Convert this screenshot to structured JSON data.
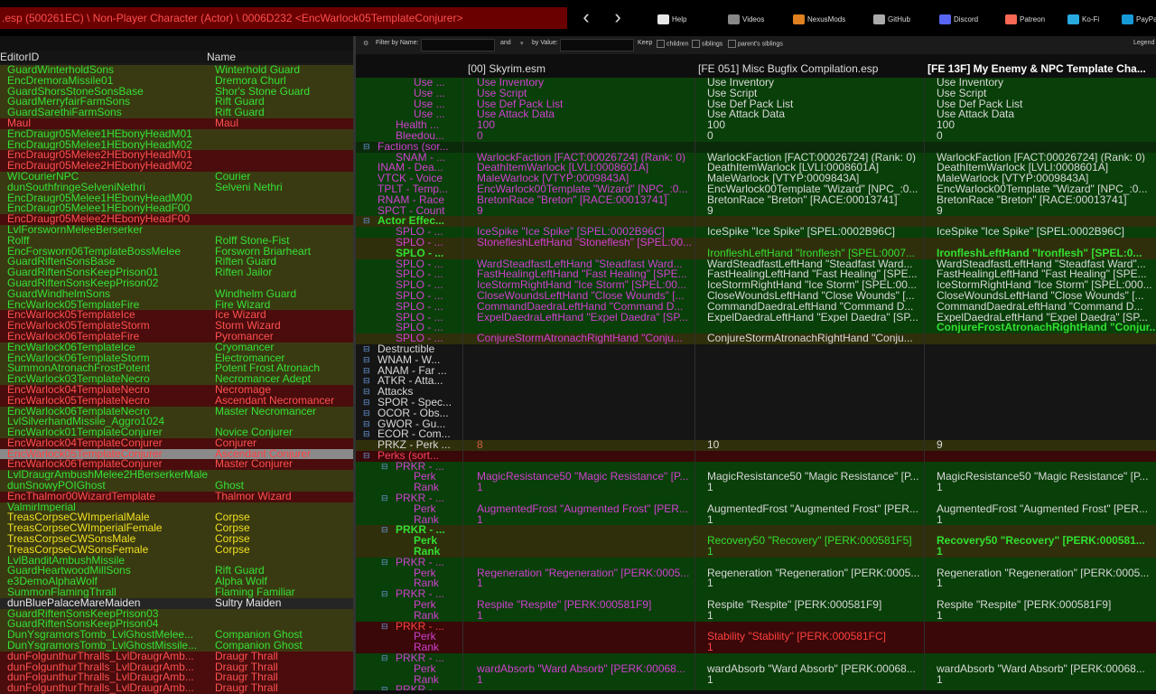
{
  "path_title": ".esp (500261EC) \\ Non-Player Character (Actor) \\ 0006D232 <EncWarlock05TemplateConjurer>",
  "toolbar": {
    "back": "‹",
    "forward": "›",
    "items": [
      {
        "label": "Help",
        "icon": "book-icon",
        "color": "#e8e8e8"
      },
      {
        "label": "Videos",
        "icon": "videos-icon",
        "color": "#888"
      },
      {
        "label": "NexusMods",
        "icon": "nexusmods-icon",
        "color": "#e08020"
      },
      {
        "label": "GitHub",
        "icon": "github-icon",
        "color": "#aaa"
      },
      {
        "label": "Discord",
        "icon": "discord-icon",
        "color": "#5865f2"
      },
      {
        "label": "Patreon",
        "icon": "patreon-icon",
        "color": "#f96854"
      },
      {
        "label": "Ko-Fi",
        "icon": "kofi-icon",
        "color": "#29abe0"
      },
      {
        "label": "PayPal",
        "icon": "paypal-icon",
        "color": "#169bd7"
      }
    ]
  },
  "left": {
    "col_editorid": "EditorID",
    "col_name": "Name",
    "rows": [
      {
        "id": "GuardWinterholdSons",
        "name": "Winterhold Guard",
        "c": "g"
      },
      {
        "id": "EncDremoraMissile01",
        "name": "Dremora Churl",
        "c": "g"
      },
      {
        "id": "GuardShorsStoneSonsBase",
        "name": "Shor's Stone Guard",
        "c": "g"
      },
      {
        "id": "GuardMerryfairFarmSons",
        "name": "Rift Guard",
        "c": "g"
      },
      {
        "id": "GuardSarethiFarmSons",
        "name": "Rift Guard",
        "c": "g"
      },
      {
        "id": "Maul",
        "name": "Maul",
        "c": "r"
      },
      {
        "id": "EncDraugr05Melee1HEbonyHeadM01",
        "name": "",
        "c": "g"
      },
      {
        "id": "EncDraugr05Melee1HEbonyHeadM02",
        "name": "",
        "c": "g"
      },
      {
        "id": "EncDraugr05Melee2HEbonyHeadM01",
        "name": "",
        "c": "r"
      },
      {
        "id": "EncDraugr05Melee2HEbonyHeadM02",
        "name": "",
        "c": "r"
      },
      {
        "id": "WICourierNPC",
        "name": "Courier",
        "c": "g"
      },
      {
        "id": "dunSouthfringeSelveniNethri",
        "name": "Selveni Nethri",
        "c": "g"
      },
      {
        "id": "EncDraugr05Melee1HEbonyHeadM00",
        "name": "",
        "c": "g"
      },
      {
        "id": "EncDraugr05Melee1HEbonyHeadF00",
        "name": "",
        "c": "g"
      },
      {
        "id": "EncDraugr05Melee2HEbonyHeadF00",
        "name": "",
        "c": "r"
      },
      {
        "id": "LvlForswornMeleeBerserker",
        "name": "",
        "c": "g"
      },
      {
        "id": "Rolff",
        "name": "Rolff Stone-Fist",
        "c": "g"
      },
      {
        "id": "EncForsworn06TemplateBossMelee",
        "name": "Forsworn Briarheart",
        "c": "g"
      },
      {
        "id": "GuardRiftenSonsBase",
        "name": "Riften Guard",
        "c": "g"
      },
      {
        "id": "GuardRiftenSonsKeepPrison01",
        "name": "Riften Jailor",
        "c": "g"
      },
      {
        "id": "GuardRiftenSonsKeepPrison02",
        "name": "",
        "c": "g"
      },
      {
        "id": "GuardWindhelmSons",
        "name": "Windhelm Guard",
        "c": "g"
      },
      {
        "id": "EncWarlock05TemplateFire",
        "name": "Fire Wizard",
        "c": "g"
      },
      {
        "id": "EncWarlock05TemplateIce",
        "name": "Ice Wizard",
        "c": "r"
      },
      {
        "id": "EncWarlock05TemplateStorm",
        "name": "Storm Wizard",
        "c": "r"
      },
      {
        "id": "EncWarlock06TemplateFire",
        "name": "Pyromancer",
        "c": "r"
      },
      {
        "id": "EncWarlock06TemplateIce",
        "name": "Cryomancer",
        "c": "g"
      },
      {
        "id": "EncWarlock06TemplateStorm",
        "name": "Electromancer",
        "c": "g"
      },
      {
        "id": "SummonAtronachFrostPotent",
        "name": "Potent Frost Atronach",
        "c": "g"
      },
      {
        "id": "EncWarlock03TemplateNecro",
        "name": "Necromancer Adept",
        "c": "g"
      },
      {
        "id": "EncWarlock04TemplateNecro",
        "name": "Necromage",
        "c": "r"
      },
      {
        "id": "EncWarlock05TemplateNecro",
        "name": "Ascendant Necromancer",
        "c": "r"
      },
      {
        "id": "EncWarlock06TemplateNecro",
        "name": "Master Necromancer",
        "c": "g"
      },
      {
        "id": "LvlSilverhandMissile_Aggro1024",
        "name": "",
        "c": "g"
      },
      {
        "id": "EncWarlock01TemplateConjurer",
        "name": "Novice Conjurer",
        "c": "g"
      },
      {
        "id": "EncWarlock04TemplateConjurer",
        "name": "Conjurer",
        "c": "r"
      },
      {
        "id": "EncWarlock05TemplateConjurer",
        "name": "Ascendant Conjurer",
        "c": "sel"
      },
      {
        "id": "EncWarlock06TemplateConjurer",
        "name": "Master Conjurer",
        "c": "r"
      },
      {
        "id": "LvlDraugrAmbushMelee2HBerserkerMale",
        "name": "",
        "c": "g"
      },
      {
        "id": "dunSnowyPOIGhost",
        "name": "Ghost",
        "c": "g"
      },
      {
        "id": "EncThalmor00WizardTemplate",
        "name": "Thalmor Wizard",
        "c": "r"
      },
      {
        "id": "ValmirImperial",
        "name": "",
        "c": "g"
      },
      {
        "id": "TreasCorpseCWImperialMale",
        "name": "Corpse",
        "c": "y"
      },
      {
        "id": "TreasCorpseCWImperialFemale",
        "name": "Corpse",
        "c": "y"
      },
      {
        "id": "TreasCorpseCWSonsMale",
        "name": "Corpse",
        "c": "y"
      },
      {
        "id": "TreasCorpseCWSonsFemale",
        "name": "Corpse",
        "c": "y"
      },
      {
        "id": "LvlBanditAmbushMissile",
        "name": "",
        "c": "g"
      },
      {
        "id": "GuardHeartwoodMillSons",
        "name": "Rift Guard",
        "c": "g"
      },
      {
        "id": "e3DemoAlphaWolf",
        "name": "Alpha Wolf",
        "c": "g"
      },
      {
        "id": "SummonFlamingThrall",
        "name": "Flaming Familiar",
        "c": "g"
      },
      {
        "id": "dunBluePalaceMareMaiden",
        "name": "Sultry Maiden",
        "c": "w"
      },
      {
        "id": "GuardRiftenSonsKeepPrison03",
        "name": "",
        "c": "g"
      },
      {
        "id": "GuardRiftenSonsKeepPrison04",
        "name": "",
        "c": "g"
      },
      {
        "id": "DunYsgramorsTomb_LvlGhostMelee...",
        "name": "Companion Ghost",
        "c": "g"
      },
      {
        "id": "DunYsgramorsTomb_LvlGhostMissile...",
        "name": "Companion Ghost",
        "c": "g"
      },
      {
        "id": "dunFolgunthurThralls_LvlDraugrAmb...",
        "name": "Draugr Thrall",
        "c": "r"
      },
      {
        "id": "dunFolgunthurThralls_LvlDraugrAmb...",
        "name": "Draugr Thrall",
        "c": "r"
      },
      {
        "id": "dunFolgunthurThralls_LvlDraugrAmb...",
        "name": "Draugr Thrall",
        "c": "r"
      },
      {
        "id": "dunFolgunthurThralls_LvlDraugrAmb...",
        "name": "Draugr Thrall",
        "c": "r"
      }
    ]
  },
  "filter": {
    "by_name": "Filter by Name:",
    "and": "and",
    "by_value": "by Value:",
    "keep": "Keep",
    "children": "children",
    "siblings": "siblings",
    "parents_siblings": "parent's siblings",
    "legend": "Legend"
  },
  "columns": [
    "[00] Skyrim.esm",
    "[FE 051] Misc Bugfix Compilation.esp",
    "[FE 13F] My Enemy & NPC Template Cha..."
  ],
  "grid": [
    {
      "l": "Use ...",
      "v": [
        "Use Inventory",
        "Use Inventory",
        "Use Inventory"
      ],
      "bg": "green",
      "lc": "mag",
      "ind": 64
    },
    {
      "l": "Use ...",
      "v": [
        "Use Script",
        "Use Script",
        "Use Script"
      ],
      "bg": "green",
      "lc": "mag",
      "ind": 64
    },
    {
      "l": "Use ...",
      "v": [
        "Use Def Pack List",
        "Use Def Pack List",
        "Use Def Pack List"
      ],
      "bg": "green",
      "lc": "mag",
      "ind": 64
    },
    {
      "l": "Use ...",
      "v": [
        "Use Attack Data",
        "Use Attack Data",
        "Use Attack Data"
      ],
      "bg": "green",
      "lc": "mag",
      "ind": 64
    },
    {
      "l": "Health ...",
      "v": [
        "100",
        "100",
        "100"
      ],
      "bg": "green",
      "lc": "mag",
      "ind": 44
    },
    {
      "l": "Bleedou...",
      "v": [
        "0",
        "0",
        "0"
      ],
      "bg": "green",
      "lc": "mag",
      "ind": 44
    },
    {
      "l": "Factions (sor...",
      "v": [
        "",
        "",
        ""
      ],
      "bg": "darkgreen",
      "lc": "mag",
      "ind": 24
    },
    {
      "l": "SNAM - ...",
      "v": [
        "WarlockFaction [FACT:00026724] (Rank: 0)",
        "WarlockFaction [FACT:00026724] (Rank: 0)",
        "WarlockFaction [FACT:00026724] (Rank: 0)"
      ],
      "bg": "green",
      "lc": "mag",
      "ind": 44
    },
    {
      "l": "INAM - Dea...",
      "v": [
        "DeathItemWarlock [LVLI:0008601A]",
        "DeathItemWarlock [LVLI:0008601A]",
        "DeathItemWarlock [LVLI:0008601A]"
      ],
      "bg": "green",
      "lc": "mag",
      "ind": 24
    },
    {
      "l": "VTCK - Voice",
      "v": [
        "MaleWarlock [VTYP:0009843A]",
        "MaleWarlock [VTYP:0009843A]",
        "MaleWarlock [VTYP:0009843A]"
      ],
      "bg": "green",
      "lc": "mag",
      "ind": 24
    },
    {
      "l": "TPLT - Temp...",
      "v": [
        "EncWarlock00Template \"Wizard\" [NPC_:0...",
        "EncWarlock00Template \"Wizard\" [NPC_:0...",
        "EncWarlock00Template \"Wizard\" [NPC_:0..."
      ],
      "bg": "green",
      "lc": "mag",
      "ind": 24
    },
    {
      "l": "RNAM - Race",
      "v": [
        "BretonRace \"Breton\" [RACE:00013741]",
        "BretonRace \"Breton\" [RACE:00013741]",
        "BretonRace \"Breton\" [RACE:00013741]"
      ],
      "bg": "green",
      "lc": "mag",
      "ind": 24
    },
    {
      "l": "SPCT - Count",
      "v": [
        "9",
        "9",
        "9"
      ],
      "bg": "green",
      "lc": "mag",
      "ind": 24
    },
    {
      "l": "Actor Effec...",
      "v": [
        "",
        "",
        ""
      ],
      "bg": "olive",
      "lc": "grn",
      "ind": 24
    },
    {
      "l": "SPLO - ...",
      "v": [
        "IceSpike \"Ice Spike\" [SPEL:0002B96C]",
        "IceSpike \"Ice Spike\" [SPEL:0002B96C]",
        "IceSpike \"Ice Spike\" [SPEL:0002B96C]"
      ],
      "bg": "green",
      "lc": "mag",
      "ind": 44
    },
    {
      "l": "SPLO - ...",
      "v": [
        "StonefleshLeftHand \"Stoneflesh\" [SPEL:00...",
        "",
        ""
      ],
      "bg": "olive",
      "lc": "mag",
      "ind": 44
    },
    {
      "l": "SPLO - ...",
      "v": [
        "",
        "IronfleshLeftHand \"Ironflesh\" [SPEL:0007...",
        "IronfleshLeftHand \"Ironflesh\" [SPEL:0..."
      ],
      "bg": "olive",
      "lc": "grn",
      "ind": 44,
      "hl": true
    },
    {
      "l": "SPLO - ...",
      "v": [
        "WardSteadfastLeftHand \"Steadfast Ward...",
        "WardSteadfastLeftHand \"Steadfast Ward...",
        "WardSteadfastLeftHand \"Steadfast Ward\"..."
      ],
      "bg": "green",
      "lc": "mag",
      "ind": 44
    },
    {
      "l": "SPLO - ...",
      "v": [
        "FastHealingLeftHand \"Fast Healing\" [SPE...",
        "FastHealingLeftHand \"Fast Healing\" [SPE...",
        "FastHealingLeftHand \"Fast Healing\" [SPE..."
      ],
      "bg": "green",
      "lc": "mag",
      "ind": 44
    },
    {
      "l": "SPLO - ...",
      "v": [
        "IceStormRightHand \"Ice Storm\" [SPEL:00...",
        "IceStormRightHand \"Ice Storm\" [SPEL:00...",
        "IceStormRightHand \"Ice Storm\" [SPEL:000..."
      ],
      "bg": "green",
      "lc": "mag",
      "ind": 44
    },
    {
      "l": "SPLO - ...",
      "v": [
        "CloseWoundsLeftHand \"Close Wounds\" [...",
        "CloseWoundsLeftHand \"Close Wounds\" [...",
        "CloseWoundsLeftHand \"Close Wounds\" [..."
      ],
      "bg": "green",
      "lc": "mag",
      "ind": 44
    },
    {
      "l": "SPLO - ...",
      "v": [
        "CommandDaedraLeftHand \"Command D...",
        "CommandDaedraLeftHand \"Command D...",
        "CommandDaedraLeftHand \"Command D..."
      ],
      "bg": "green",
      "lc": "mag",
      "ind": 44
    },
    {
      "l": "SPLO - ...",
      "v": [
        "ExpelDaedraLeftHand \"Expel Daedra\" [SP...",
        "ExpelDaedraLeftHand \"Expel Daedra\" [SP...",
        "ExpelDaedraLeftHand \"Expel Daedra\" [SP..."
      ],
      "bg": "green",
      "lc": "mag",
      "ind": 44
    },
    {
      "l": "SPLO - ...",
      "v": [
        "",
        "",
        "ConjureFrostAtronachRightHand \"Conjur..."
      ],
      "bg": "green",
      "lc": "mag",
      "ind": 44,
      "v2green": true
    },
    {
      "l": "SPLO - ...",
      "v": [
        "ConjureStormAtronachRightHand \"Conju...",
        "ConjureStormAtronachRightHand \"Conju...",
        ""
      ],
      "bg": "olive",
      "lc": "mag",
      "ind": 44
    },
    {
      "l": "Destructible",
      "v": [
        "",
        "",
        ""
      ],
      "bg": "dark",
      "lc": "lite",
      "ind": 24
    },
    {
      "l": "WNAM - W...",
      "v": [
        "",
        "",
        ""
      ],
      "bg": "dark",
      "lc": "lite",
      "ind": 24
    },
    {
      "l": "ANAM - Far ...",
      "v": [
        "",
        "",
        ""
      ],
      "bg": "dark",
      "lc": "lite",
      "ind": 24
    },
    {
      "l": "ATKR - Atta...",
      "v": [
        "",
        "",
        ""
      ],
      "bg": "dark",
      "lc": "lite",
      "ind": 24
    },
    {
      "l": "Attacks",
      "v": [
        "",
        "",
        ""
      ],
      "bg": "dark",
      "lc": "lite",
      "ind": 24
    },
    {
      "l": "SPOR - Spec...",
      "v": [
        "",
        "",
        ""
      ],
      "bg": "dark",
      "lc": "lite",
      "ind": 24
    },
    {
      "l": "OCOR - Obs...",
      "v": [
        "",
        "",
        ""
      ],
      "bg": "dark",
      "lc": "lite",
      "ind": 24
    },
    {
      "l": "GWOR - Gu...",
      "v": [
        "",
        "",
        ""
      ],
      "bg": "dark",
      "lc": "lite",
      "ind": 24
    },
    {
      "l": "ECOR - Com...",
      "v": [
        "",
        "",
        ""
      ],
      "bg": "dark",
      "lc": "lite",
      "ind": 24
    },
    {
      "l": "PRKZ - Perk ...",
      "v": [
        "8",
        "10",
        "9"
      ],
      "bg": "olive",
      "lc": "lite",
      "ind": 24,
      "v0red": true
    },
    {
      "l": "Perks (sort...",
      "v": [
        "",
        "",
        ""
      ],
      "bg": "red",
      "lc": "hdr-red",
      "ind": 24
    },
    {
      "l": "PRKR - ...",
      "v": [
        "",
        "",
        ""
      ],
      "bg": "green",
      "lc": "mag",
      "ind": 44
    },
    {
      "l": "Perk",
      "v": [
        "MagicResistance50 \"Magic Resistance\" [P...",
        "MagicResistance50 \"Magic Resistance\" [P...",
        "MagicResistance50 \"Magic Resistance\" [P..."
      ],
      "bg": "green",
      "lc": "mag",
      "ind": 64
    },
    {
      "l": "Rank",
      "v": [
        "1",
        "1",
        "1"
      ],
      "bg": "green",
      "lc": "mag",
      "ind": 64
    },
    {
      "l": "PRKR - ...",
      "v": [
        "",
        "",
        ""
      ],
      "bg": "green",
      "lc": "mag",
      "ind": 44
    },
    {
      "l": "Perk",
      "v": [
        "AugmentedFrost \"Augmented Frost\" [PER...",
        "AugmentedFrost \"Augmented Frost\" [PER...",
        "AugmentedFrost \"Augmented Frost\" [PER..."
      ],
      "bg": "green",
      "lc": "mag",
      "ind": 64
    },
    {
      "l": "Rank",
      "v": [
        "1",
        "1",
        "1"
      ],
      "bg": "green",
      "lc": "mag",
      "ind": 64
    },
    {
      "l": "PRKR - ...",
      "v": [
        "",
        "",
        ""
      ],
      "bg": "olive",
      "lc": "grn",
      "ind": 44
    },
    {
      "l": "Perk",
      "v": [
        "",
        "Recovery50 \"Recovery\" [PERK:000581F5]",
        "Recovery50 \"Recovery\" [PERK:000581..."
      ],
      "bg": "olive",
      "lc": "grn",
      "ind": 64,
      "hl": true
    },
    {
      "l": "Rank",
      "v": [
        "",
        "1",
        "1"
      ],
      "bg": "olive",
      "lc": "grn",
      "ind": 64,
      "hl": true
    },
    {
      "l": "PRKR - ...",
      "v": [
        "",
        "",
        ""
      ],
      "bg": "green",
      "lc": "mag",
      "ind": 44
    },
    {
      "l": "Perk",
      "v": [
        "Regeneration \"Regeneration\" [PERK:0005...",
        "Regeneration \"Regeneration\" [PERK:0005...",
        "Regeneration \"Regeneration\" [PERK:0005..."
      ],
      "bg": "green",
      "lc": "mag",
      "ind": 64
    },
    {
      "l": "Rank",
      "v": [
        "1",
        "1",
        "1"
      ],
      "bg": "green",
      "lc": "mag",
      "ind": 64
    },
    {
      "l": "PRKR - ...",
      "v": [
        "",
        "",
        ""
      ],
      "bg": "green",
      "lc": "mag",
      "ind": 44
    },
    {
      "l": "Perk",
      "v": [
        "Respite \"Respite\" [PERK:000581F9]",
        "Respite \"Respite\" [PERK:000581F9]",
        "Respite \"Respite\" [PERK:000581F9]"
      ],
      "bg": "green",
      "lc": "mag",
      "ind": 64
    },
    {
      "l": "Rank",
      "v": [
        "1",
        "1",
        "1"
      ],
      "bg": "green",
      "lc": "mag",
      "ind": 64
    },
    {
      "l": "PRKR - ...",
      "v": [
        "",
        "",
        ""
      ],
      "bg": "red",
      "lc": "red-t",
      "ind": 44
    },
    {
      "l": "Perk",
      "v": [
        "",
        "Stability \"Stability\" [PERK:000581FC]",
        ""
      ],
      "bg": "red",
      "lc": "mag",
      "ind": 64,
      "v1red": true
    },
    {
      "l": "Rank",
      "v": [
        "",
        "1",
        ""
      ],
      "bg": "red",
      "lc": "mag",
      "ind": 64,
      "v1red": true
    },
    {
      "l": "PRKR - ...",
      "v": [
        "",
        "",
        ""
      ],
      "bg": "green",
      "lc": "mag",
      "ind": 44
    },
    {
      "l": "Perk",
      "v": [
        "wardAbsorb \"Ward Absorb\" [PERK:00068...",
        "wardAbsorb \"Ward Absorb\" [PERK:00068...",
        "wardAbsorb \"Ward Absorb\" [PERK:00068..."
      ],
      "bg": "green",
      "lc": "mag",
      "ind": 64
    },
    {
      "l": "Rank",
      "v": [
        "1",
        "1",
        "1"
      ],
      "bg": "green",
      "lc": "mag",
      "ind": 64
    },
    {
      "l": "PRKR - ...",
      "v": [
        "",
        "",
        ""
      ],
      "bg": "green",
      "lc": "mag",
      "ind": 44
    }
  ]
}
